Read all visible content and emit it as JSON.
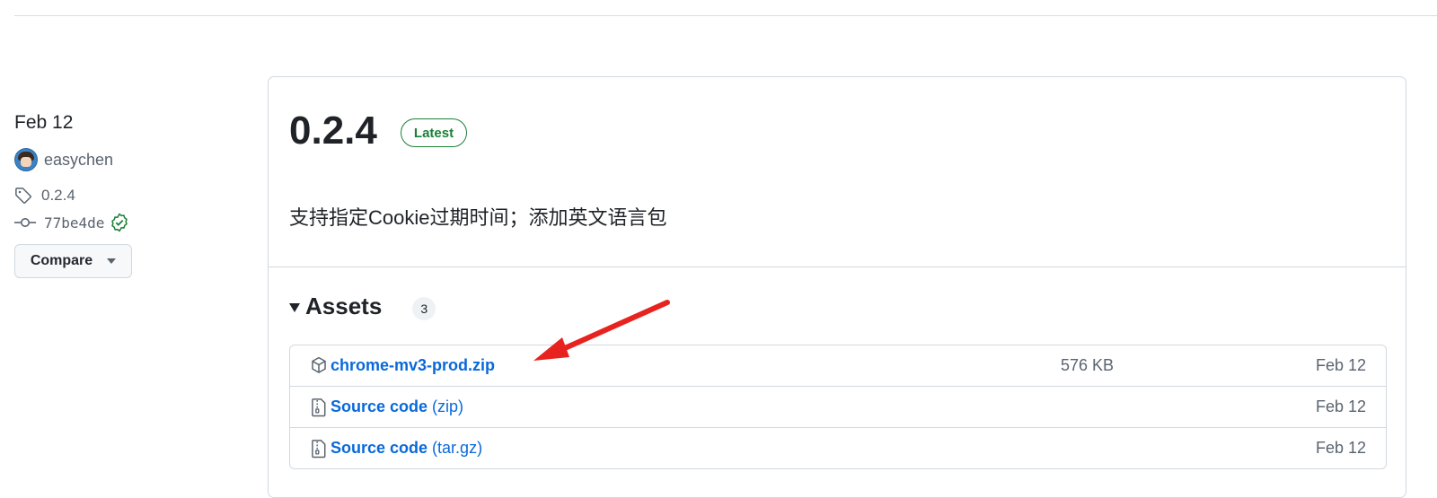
{
  "meta": {
    "date": "Feb 12",
    "author": "easychen",
    "tag": "0.2.4",
    "commit": "77be4de",
    "compare_label": "Compare"
  },
  "release": {
    "title": "0.2.4",
    "badge": "Latest",
    "notes": "支持指定Cookie过期时间；添加英文语言包"
  },
  "assets": {
    "title": "Assets",
    "count": "3",
    "items": [
      {
        "name": "chrome-mv3-prod.zip",
        "suffix": "",
        "size": "576 KB",
        "date": "Feb 12",
        "icon": "package-icon"
      },
      {
        "name": "Source code",
        "suffix": " (zip)",
        "size": "",
        "date": "Feb 12",
        "icon": "file-zip-icon"
      },
      {
        "name": "Source code",
        "suffix": " (tar.gz)",
        "size": "",
        "date": "Feb 12",
        "icon": "file-zip-icon"
      }
    ]
  },
  "colors": {
    "link": "#0969da",
    "badge_green": "#1a7f37",
    "annotation_arrow": "#e8231f"
  }
}
